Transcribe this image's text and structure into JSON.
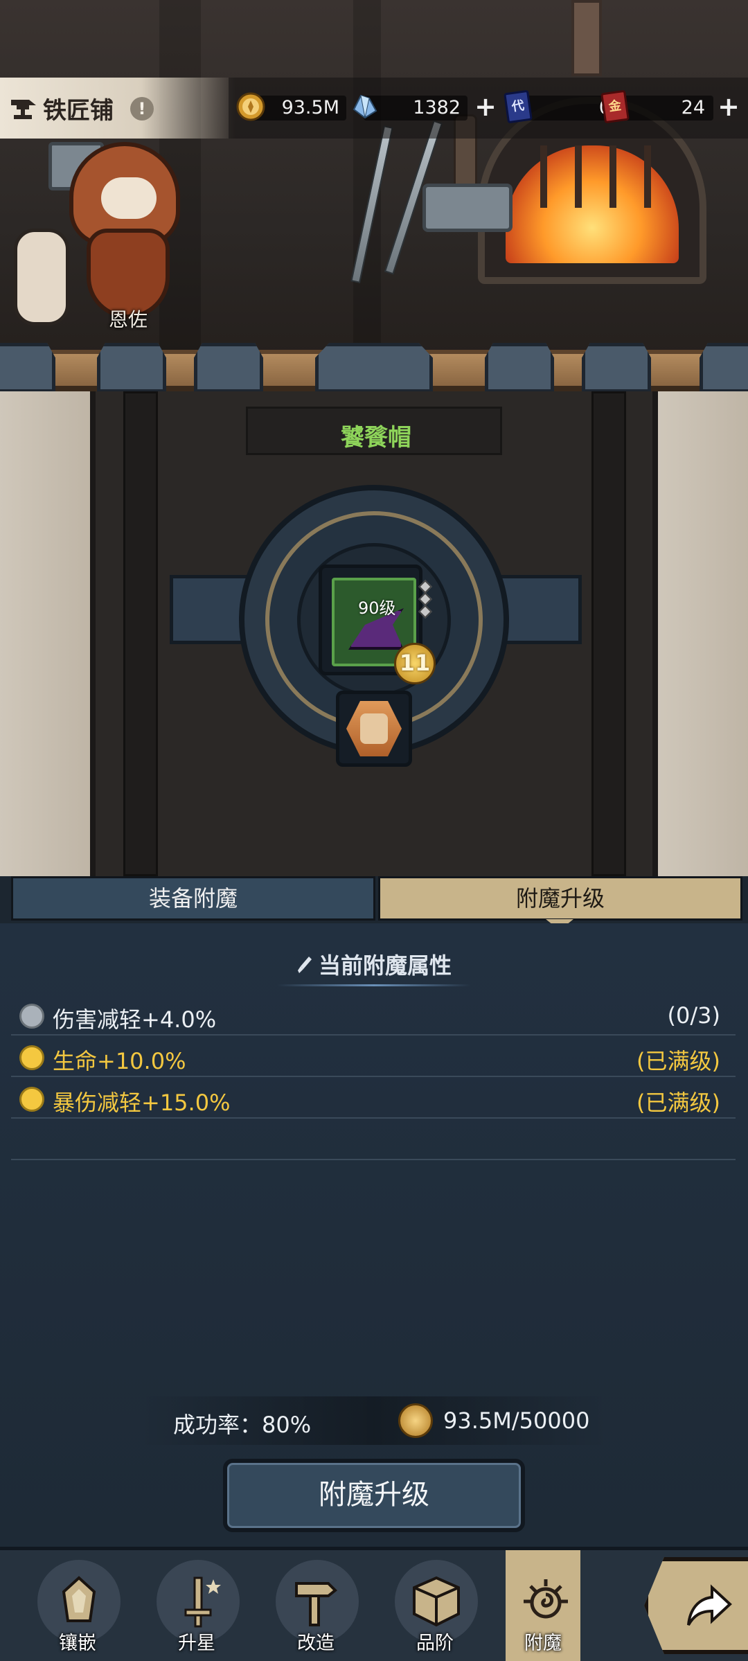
{
  "header": {
    "title": "铁匠铺",
    "info_badge": "!",
    "resources": [
      {
        "icon": "gold-coin-icon",
        "value": "93.5M",
        "has_plus": false
      },
      {
        "icon": "crystal-icon",
        "value": "1382",
        "has_plus": true
      },
      {
        "icon": "blue-card-icon",
        "card_text": "代",
        "value": "0",
        "has_plus": false
      },
      {
        "icon": "red-card-icon",
        "card_text": "金",
        "value": "24",
        "has_plus": true
      }
    ]
  },
  "scene": {
    "npc_name": "恩佐"
  },
  "equipment": {
    "name": "饕餮帽",
    "level_label": "90级",
    "star_level": "11",
    "rarity_color": "#5aa04a",
    "gem_slots": 3
  },
  "tabs": [
    {
      "label": "装备附魔",
      "active": false
    },
    {
      "label": "附魔升级",
      "active": true
    }
  ],
  "attributes": {
    "title": "当前附魔属性",
    "rows": [
      {
        "name": "伤害减轻+4.0%",
        "status": "(0/3)",
        "tier": "grey"
      },
      {
        "name": "生命+10.0%",
        "status": "(已满级)",
        "tier": "gold"
      },
      {
        "name": "暴伤减轻+15.0%",
        "status": "(已满级)",
        "tier": "gold"
      }
    ]
  },
  "cost": {
    "success_rate": "成功率：80%",
    "gold_cost": "93.5M/50000"
  },
  "actions": {
    "upgrade_label": "附魔升级"
  },
  "bottom_nav": [
    {
      "label": "镶嵌",
      "icon": "gem-inlay-icon",
      "active": false
    },
    {
      "label": "升星",
      "icon": "sword-star-icon",
      "active": false
    },
    {
      "label": "改造",
      "icon": "hammer-icon",
      "active": false
    },
    {
      "label": "品阶",
      "icon": "box-icon",
      "active": false
    },
    {
      "label": "附魔",
      "icon": "enchant-swirl-icon",
      "active": true
    }
  ],
  "colors": {
    "accent_tan": "#c8b48a",
    "panel_blue": "#34495c",
    "gold_text": "#f4c840",
    "item_name_green": "#8ed45a"
  }
}
